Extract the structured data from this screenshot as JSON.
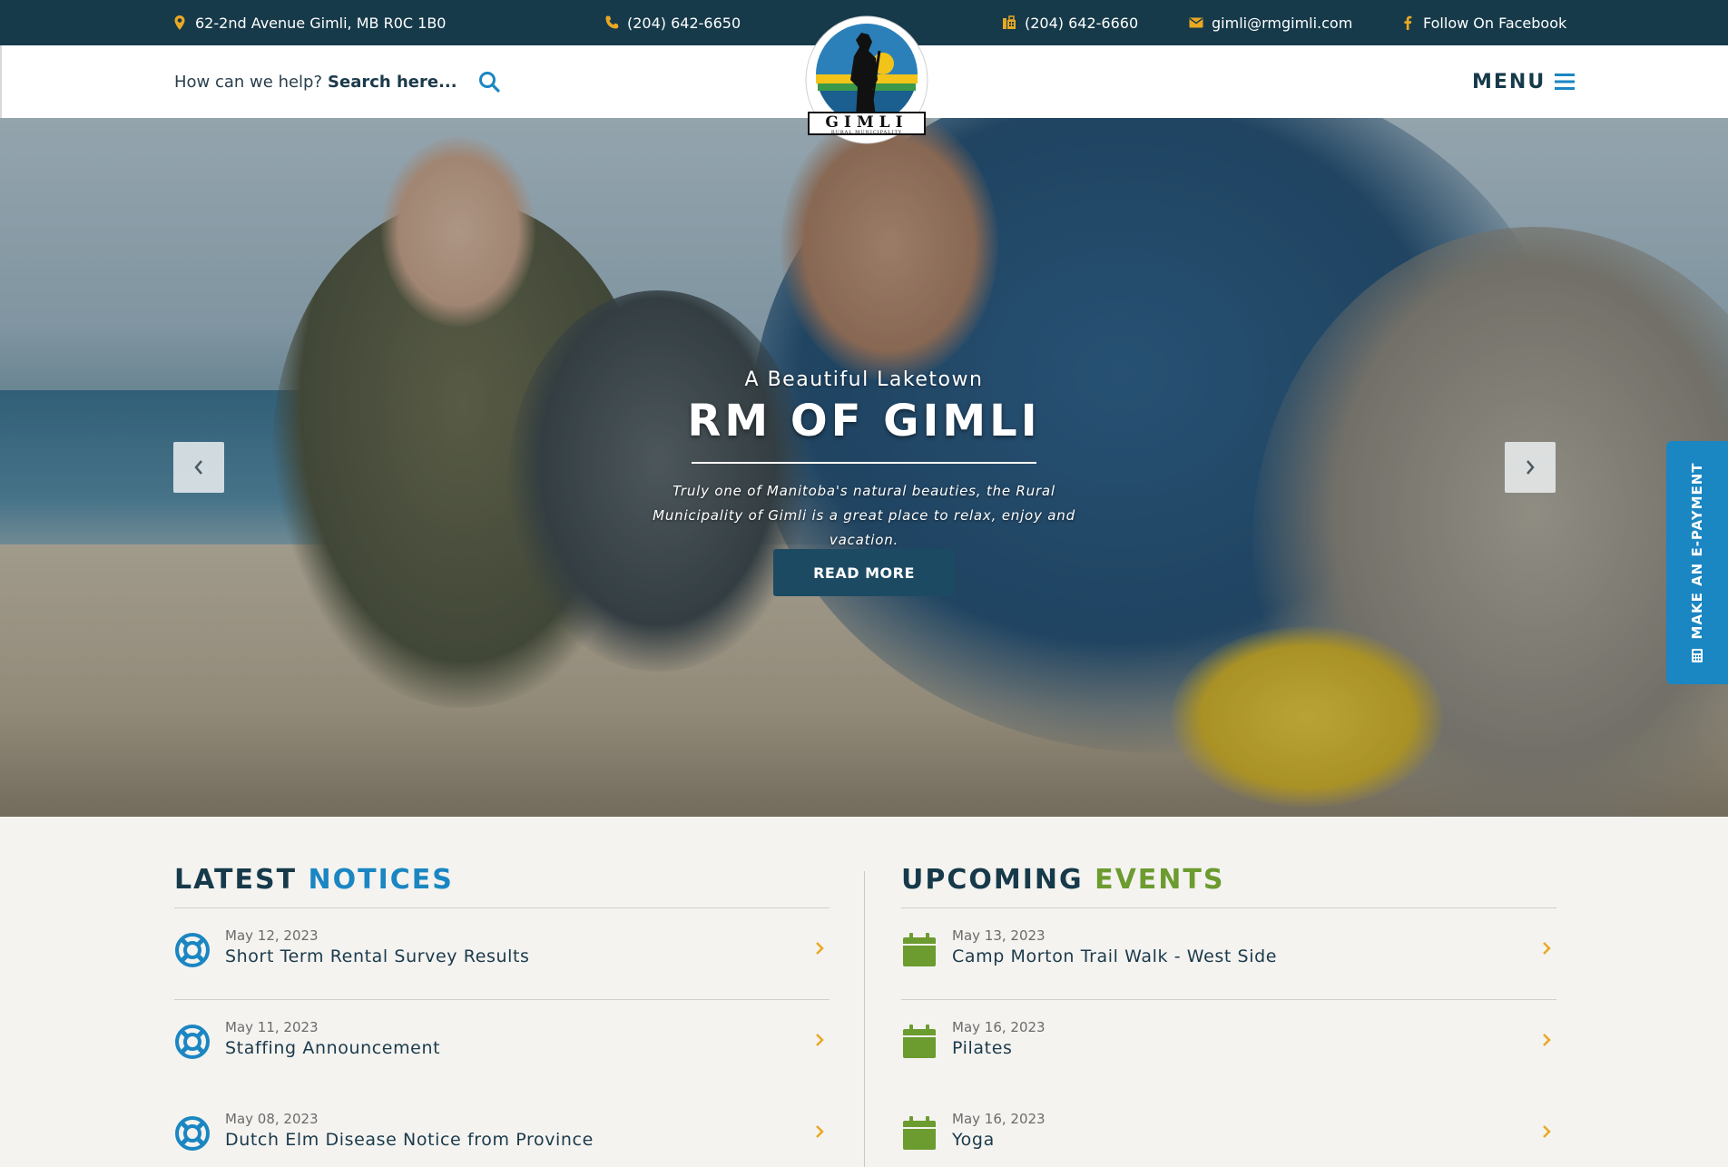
{
  "topbar": {
    "address": "62-2nd Avenue Gimli, MB R0C 1B0",
    "phone": "(204) 642-6650",
    "fax": "(204) 642-6660",
    "email": "gimli@rmgimli.com",
    "facebook": "Follow On Facebook"
  },
  "header": {
    "search_prompt": "How can we help?",
    "search_placeholder": "Search here...",
    "menu_label": "MENU"
  },
  "logo": {
    "name": "GIMLI",
    "subtitle": "RURAL MUNICIPALITY"
  },
  "hero": {
    "kicker": "A Beautiful Laketown",
    "title": "RM OF GIMLI",
    "description": "Truly one of Manitoba's natural beauties, the Rural Municipality of Gimli is a great place to relax, enjoy and vacation.",
    "cta": "READ MORE"
  },
  "epayment": {
    "label": "MAKE AN E-PAYMENT"
  },
  "notices": {
    "title_a": "LATEST",
    "title_b": "NOTICES",
    "items": [
      {
        "date": "May 12, 2023",
        "title": "Short Term Rental Survey Results"
      },
      {
        "date": "May 11, 2023",
        "title": "Staffing Announcement"
      },
      {
        "date": "May 08, 2023",
        "title": "Dutch Elm Disease Notice from Province"
      }
    ]
  },
  "events": {
    "title_a": "UPCOMING",
    "title_b": "EVENTS",
    "items": [
      {
        "date": "May 13, 2023",
        "title": "Camp Morton Trail Walk - West Side"
      },
      {
        "date": "May 16, 2023",
        "title": "Pilates"
      },
      {
        "date": "May 16, 2023",
        "title": "Yoga"
      }
    ]
  },
  "colors": {
    "navy": "#163a4a",
    "accent_blue": "#1a86c2",
    "accent_green": "#6c9b2f",
    "accent_gold": "#e9a823"
  }
}
